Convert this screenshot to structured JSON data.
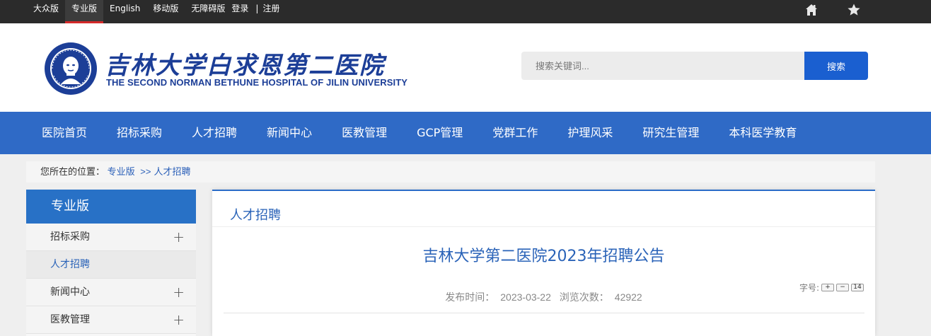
{
  "topbar": {
    "links": [
      "大众版",
      "专业版",
      "English",
      "移动版",
      "无障碍版"
    ],
    "active_index": 1,
    "login": "登录",
    "separator": "|",
    "register": "注册",
    "icons": [
      "home-icon",
      "star-icon"
    ]
  },
  "header": {
    "logo_cn": "吉林大学白求恩第二医院",
    "logo_en": "THE SECOND NORMAN BETHUNE HOSPITAL OF JILIN UNIVERSITY",
    "search_placeholder": "搜索关键词...",
    "search_button": "搜索"
  },
  "nav": {
    "items": [
      "医院首页",
      "招标采购",
      "人才招聘",
      "新闻中心",
      "医教管理",
      "GCP管理",
      "党群工作",
      "护理风采",
      "研究生管理",
      "本科医学教育"
    ]
  },
  "breadcrumb": {
    "prefix": "您所在的位置：",
    "items": [
      "专业版",
      "人才招聘"
    ],
    "separator": ">>"
  },
  "sidebar": {
    "title": "专业版",
    "items": [
      {
        "label": "招标采购",
        "expandable": true,
        "active": false
      },
      {
        "label": "人才招聘",
        "expandable": false,
        "active": true
      },
      {
        "label": "新闻中心",
        "expandable": true,
        "active": false
      },
      {
        "label": "医教管理",
        "expandable": true,
        "active": false
      }
    ],
    "expand_symbol": "+"
  },
  "main": {
    "section_title": "人才招聘",
    "article_title": "吉林大学第二医院2023年招聘公告",
    "font_size_label": "字号:",
    "font_buttons": [
      "+",
      "−",
      "14"
    ],
    "publish_label": "发布时间：",
    "publish_date": "2023-03-22",
    "views_label": "浏览次数：",
    "views_count": "42922"
  },
  "colors": {
    "topbar": "#2b2b2b",
    "nav": "#2f6ac6",
    "accent": "#2a63b8",
    "search_button": "#1a5fd0",
    "active_tab_underline": "#d42a2a"
  }
}
